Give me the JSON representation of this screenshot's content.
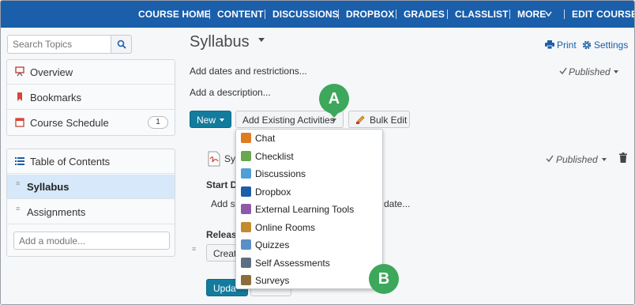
{
  "nav": {
    "items": [
      "COURSE HOME",
      "CONTENT",
      "DISCUSSIONS",
      "DROPBOX",
      "GRADES",
      "CLASSLIST",
      "MORE"
    ],
    "edit_course": "EDIT COURSE"
  },
  "sidebar": {
    "search_placeholder": "Search Topics",
    "items": [
      {
        "label": "Overview",
        "icon": "overview-icon"
      },
      {
        "label": "Bookmarks",
        "icon": "bookmark-icon"
      },
      {
        "label": "Course Schedule",
        "icon": "calendar-icon",
        "count": "1"
      }
    ],
    "toc": {
      "label": "Table of Contents",
      "modules": [
        {
          "label": "Syllabus",
          "selected": true
        },
        {
          "label": "Assignments",
          "selected": false
        }
      ]
    },
    "add_module_placeholder": "Add a module..."
  },
  "main": {
    "title": "Syllabus",
    "print": "Print",
    "settings": "Settings",
    "add_dates": "Add dates and restrictions...",
    "add_description": "Add a description...",
    "published": "Published",
    "new_button": "New",
    "add_existing": "Add Existing Activities",
    "bulk_edit": "Bulk Edit",
    "topic_partial": "Sy",
    "start_partial": "Start Da",
    "add_start_partial": "Add st",
    "date_partial": "date...",
    "release_partial": "Releas",
    "create_partial": "Create",
    "update_partial": "Upda"
  },
  "dropdown": {
    "items": [
      {
        "label": "Chat",
        "icon": "chat-icon",
        "color": "#e07b1f"
      },
      {
        "label": "Checklist",
        "icon": "checklist-icon",
        "color": "#6aa84f"
      },
      {
        "label": "Discussions",
        "icon": "discussions-icon",
        "color": "#4f9fd6"
      },
      {
        "label": "Dropbox",
        "icon": "dropbox-icon",
        "color": "#1b5eaa"
      },
      {
        "label": "External Learning Tools",
        "icon": "external-tools-icon",
        "color": "#8e5aa8"
      },
      {
        "label": "Online Rooms",
        "icon": "online-rooms-icon",
        "color": "#c28b2e"
      },
      {
        "label": "Quizzes",
        "icon": "quizzes-icon",
        "color": "#5b8fc7"
      },
      {
        "label": "Self Assessments",
        "icon": "self-assessments-icon",
        "color": "#5c6f82"
      },
      {
        "label": "Surveys",
        "icon": "surveys-icon",
        "color": "#8a6d3b"
      }
    ]
  },
  "callouts": {
    "a": "A",
    "b": "B"
  },
  "colors": {
    "nav": "#1b5eaa",
    "accent": "#006fbf",
    "callout": "#3da75c",
    "selected": "#d6e8fa"
  }
}
